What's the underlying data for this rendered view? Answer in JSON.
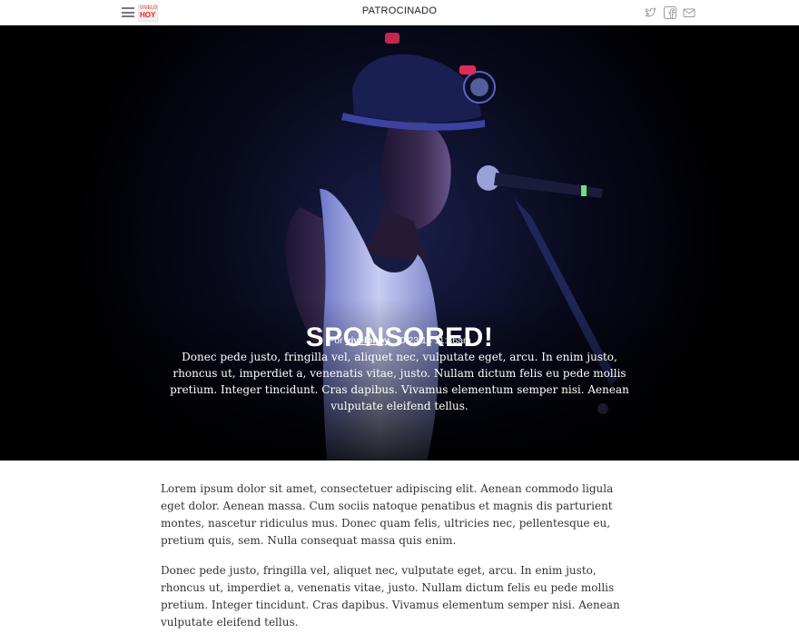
{
  "header": {
    "logo_top": "VIVELO",
    "logo_bottom": "HOY",
    "title": "PATROCINADO"
  },
  "social_icons": [
    "twitter-icon",
    "facebook-icon",
    "email-icon"
  ],
  "hero": {
    "title": "SPONSORED!",
    "byline_prefix": "Por",
    "author": "vivelohoy",
    "date": "10/23/14 11:36am",
    "summary": "Donec pede justo, fringilla vel, aliquet nec, vulputate eget, arcu. In enim justo, rhoncus ut, imperdiet a, venenatis vitae, justo. Nullam dictum felis eu pede mollis pretium. Integer tincidunt. Cras dapibus. Vivamus elementum semper nisi. Aenean vulputate eleifend tellus."
  },
  "article": {
    "paragraphs": [
      "Lorem ipsum dolor sit amet, consectetuer adipiscing elit. Aenean commodo ligula eget dolor. Aenean massa. Cum sociis natoque penatibus et magnis dis parturient montes, nascetur ridiculus mus. Donec quam felis, ultricies nec, pellentesque eu, pretium quis, sem. Nulla consequat massa quis enim.",
      "Donec pede justo, fringilla vel, aliquet nec, vulputate eget, arcu. In enim justo, rhoncus ut, imperdiet a, venenatis vitae, justo. Nullam dictum felis eu pede mollis pretium. Integer tincidunt. Cras dapibus. Vivamus elementum semper nisi. Aenean vulputate eleifend tellus."
    ]
  },
  "colors": {
    "brand_red": "#e1261c",
    "hero_background": "#000000",
    "body_text": "#333333"
  }
}
